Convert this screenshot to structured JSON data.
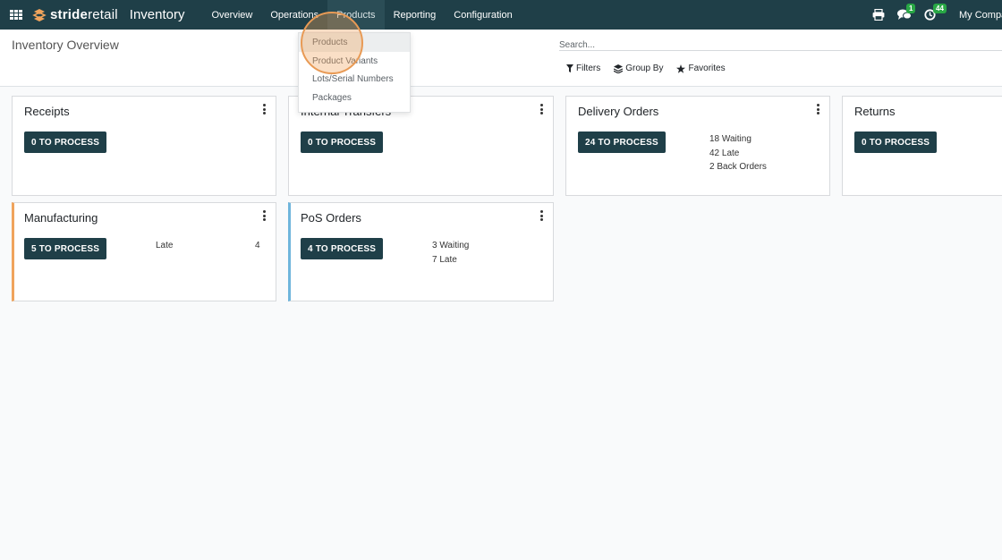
{
  "navbar": {
    "brand_strong": "stride",
    "brand_light": "retail",
    "app_title": "Inventory",
    "menu": [
      "Overview",
      "Operations",
      "Products",
      "Reporting",
      "Configuration"
    ],
    "active_menu": "Products",
    "messages_count": "1",
    "activities_count": "44",
    "company": "My Company"
  },
  "control_panel": {
    "title": "Inventory Overview",
    "search_placeholder": "Search...",
    "filters_label": "Filters",
    "group_by_label": "Group By",
    "favorites_label": "Favorites"
  },
  "dropdown": {
    "items": [
      "Products",
      "Product Variants",
      "Lots/Serial Numbers",
      "Packages"
    ],
    "highlighted": "Products"
  },
  "cards": [
    {
      "title": "Receipts",
      "button": "0 TO PROCESS",
      "stats": []
    },
    {
      "title": "Internal Transfers",
      "button": "0 TO PROCESS",
      "stats": []
    },
    {
      "title": "Delivery Orders",
      "button": "24 TO PROCESS",
      "stats": [
        "18 Waiting",
        "42 Late",
        "2 Back Orders"
      ]
    },
    {
      "title": "Returns",
      "button": "0 TO PROCESS",
      "stats": []
    },
    {
      "title": "Manufacturing",
      "button": "5 TO PROCESS",
      "stat_label": "Late",
      "stat_value": "4",
      "accent": "#f0a45c"
    },
    {
      "title": "PoS Orders",
      "button": "4 TO PROCESS",
      "stats": [
        "3 Waiting",
        "7 Late"
      ],
      "accent": "#6fb5dc"
    }
  ],
  "colors": {
    "navbar": "#1f3f48",
    "button": "#1f3f48",
    "badge": "#28a745"
  }
}
